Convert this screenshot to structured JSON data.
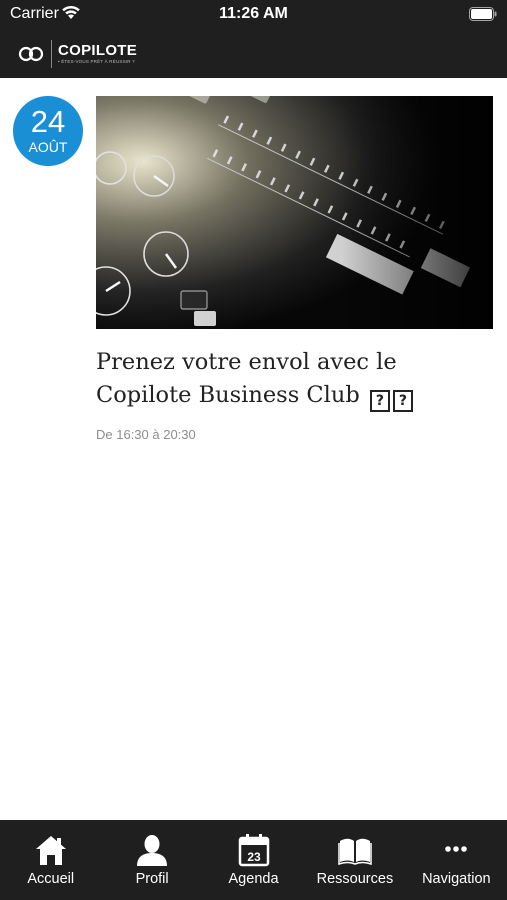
{
  "status_bar": {
    "carrier": "Carrier",
    "time": "11:26 AM"
  },
  "header": {
    "logo_name": "COPILOTE",
    "logo_tagline": "• ÊTES-VOUS PRÊT À RÉUSSIR ?"
  },
  "event": {
    "day": "24",
    "month": "AOÛT",
    "title": "Prenez votre envol avec le Copilote Business Club",
    "time": "De 16:30 à 20:30"
  },
  "tabs": [
    {
      "label": "Accueil",
      "icon": "home-icon"
    },
    {
      "label": "Profil",
      "icon": "person-icon"
    },
    {
      "label": "Agenda",
      "icon": "calendar-icon",
      "calendar_day": "23"
    },
    {
      "label": "Ressources",
      "icon": "book-icon"
    },
    {
      "label": "Navigation",
      "icon": "more-icon"
    }
  ],
  "colors": {
    "bar": "#1f1f1f",
    "accent": "#1a8fd6",
    "time_text": "#8d8d8d"
  }
}
